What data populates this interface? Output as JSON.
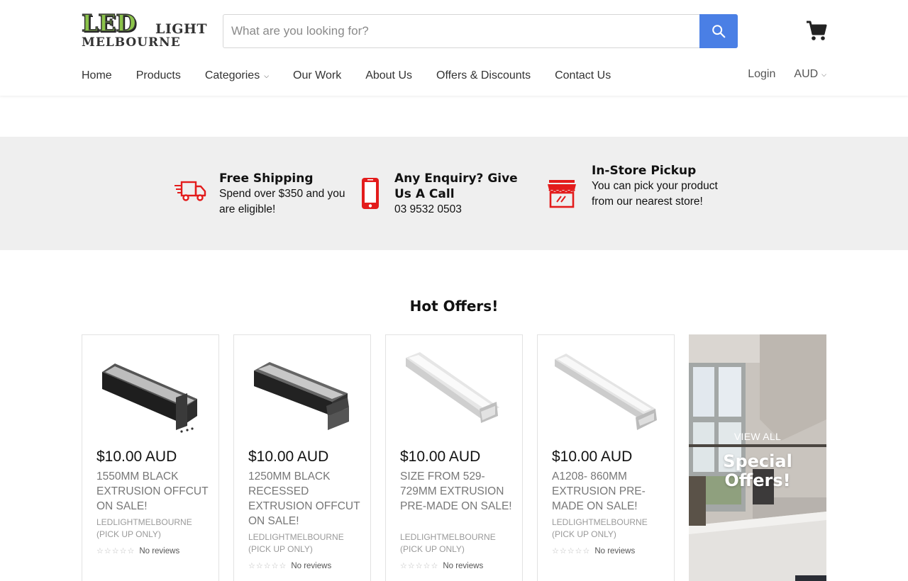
{
  "brand": {
    "logo_top": "LED",
    "logo_side": "LIGHT",
    "logo_bottom": "MELBOURNE"
  },
  "search": {
    "placeholder": "What are you looking for?",
    "value": ""
  },
  "icons": {
    "search": "search-icon",
    "cart": "cart-icon",
    "shipping": "delivery-truck-icon",
    "phone": "mobile-phone-icon",
    "store": "storefront-icon"
  },
  "colors": {
    "accent": "#4a7fe5",
    "feature_icon": "#e31c1c",
    "band_bg": "#efefef"
  },
  "nav": {
    "items": [
      {
        "label": "Home"
      },
      {
        "label": "Products"
      },
      {
        "label": "Categories"
      },
      {
        "label": "Our Work"
      },
      {
        "label": "About Us"
      },
      {
        "label": "Offers & Discounts"
      },
      {
        "label": "Contact Us"
      }
    ],
    "login": "Login",
    "currency": "AUD"
  },
  "features": [
    {
      "title": "Free Shipping",
      "text": "Spend over $350 and you are eligible!"
    },
    {
      "title": "Any Enquiry? Give Us A Call",
      "text": "03 9532 0503"
    },
    {
      "title": "In-Store Pickup",
      "text": "You can pick your product from our nearest store!"
    }
  ],
  "hot_offers": {
    "title": "Hot Offers!",
    "products": [
      {
        "price": "$10.00 AUD",
        "title": "1550MM BLACK EXTRUSION OFFCUT ON SALE!",
        "vendor": "LEDLIGHTMELBOURNE (PICK UP ONLY)",
        "reviews": "No reviews"
      },
      {
        "price": "$10.00 AUD",
        "title": "1250MM BLACK RECESSED EXTRUSION OFFCUT ON SALE!",
        "vendor": "LEDLIGHTMELBOURNE (PICK UP ONLY)",
        "reviews": "No reviews"
      },
      {
        "price": "$10.00 AUD",
        "title": "SIZE FROM 529-729MM EXTRUSION PRE-MADE ON SALE!",
        "vendor": "LEDLIGHTMELBOURNE (PICK UP ONLY)",
        "reviews": "No reviews"
      },
      {
        "price": "$10.00 AUD",
        "title": "A1208- 860MM EXTRUSION PRE-MADE ON SALE!",
        "vendor": "LEDLIGHTMELBOURNE (PICK UP ONLY)",
        "reviews": "No reviews"
      }
    ],
    "promo": {
      "view_all": "VIEW ALL",
      "headline": "Special Offers!"
    }
  }
}
